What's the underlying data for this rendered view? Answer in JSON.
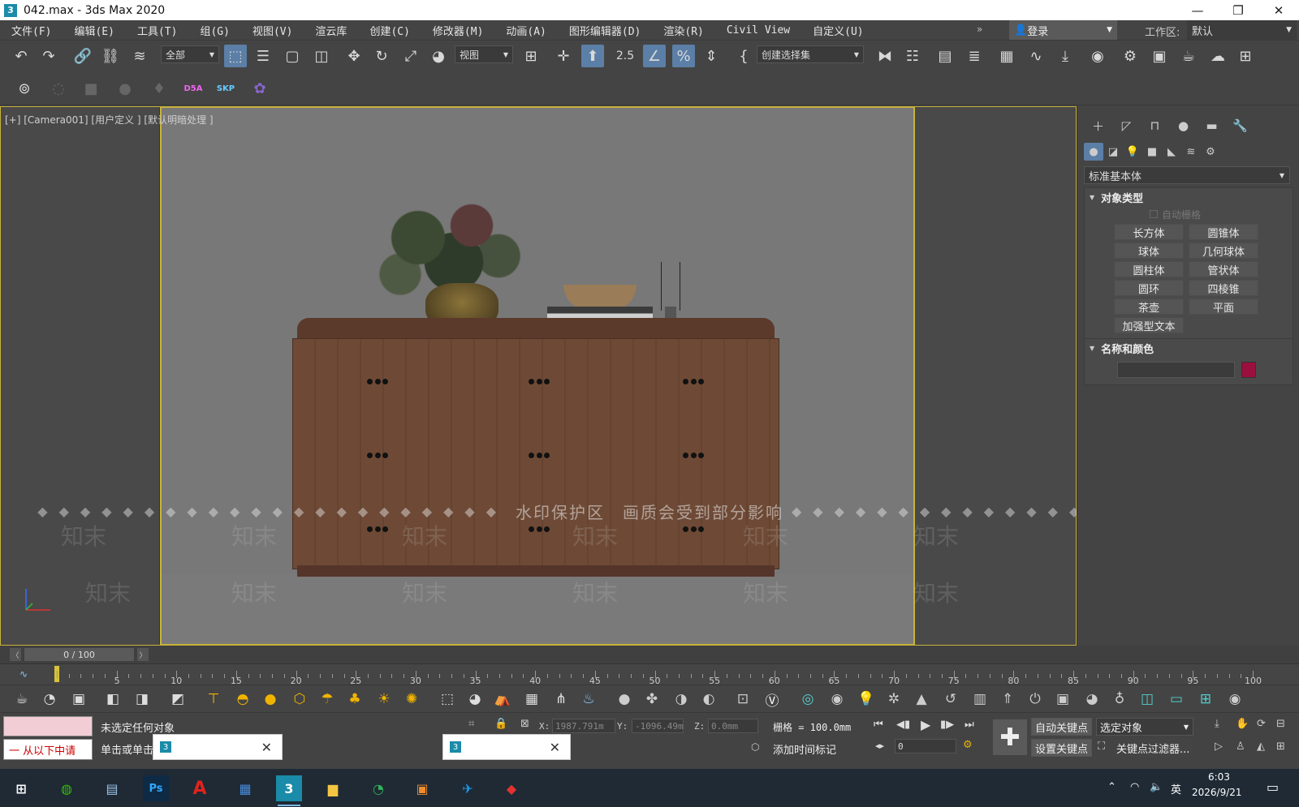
{
  "window": {
    "title": "042.max - 3ds Max 2020",
    "app_icon": "3",
    "controls": [
      "—",
      "❐",
      "✕"
    ]
  },
  "menu": {
    "items": [
      "文件(F)",
      "编辑(E)",
      "工具(T)",
      "组(G)",
      "视图(V)",
      "渲云库",
      "创建(C)",
      "修改器(M)",
      "动画(A)",
      "图形编辑器(D)",
      "渲染(R)",
      "Civil View",
      "自定义(U)"
    ],
    "overflow": "»",
    "login": "登录",
    "workspace_label": "工作区:",
    "workspace_value": "默认"
  },
  "toolbar": {
    "selection_filter": "全部",
    "ref_coord": "视图",
    "named_selection": "创建选择集",
    "snap_value": "2.5"
  },
  "toolbar2": {
    "d5a_label": "D5A",
    "skp_label": "SKP"
  },
  "viewport": {
    "label": "[+] [Camera001] [用户定义 ] [默认明暗处理 ]",
    "watermark_text": "水印保护区　画质会受到部分影响",
    "watermark_logo": "知末"
  },
  "command_panel": {
    "category": "标准基本体",
    "object_type_title": "对象类型",
    "autogrid": "自动栅格",
    "primitives": [
      "长方体",
      "圆锥体",
      "球体",
      "几何球体",
      "圆柱体",
      "管状体",
      "圆环",
      "四棱锥",
      "茶壶",
      "平面",
      "加强型文本"
    ],
    "name_color_title": "名称和颜色",
    "object_color": "#9b0f3e"
  },
  "timeline": {
    "frame_display": "0 / 100",
    "ticks": [
      5,
      10,
      15,
      20,
      25,
      30,
      35,
      40,
      45,
      50,
      55,
      60,
      65,
      70,
      75,
      80,
      85,
      90,
      95,
      100
    ]
  },
  "status": {
    "listener_text": "一 从以下中请",
    "selection_status": "未选定任何对象",
    "prompt": "单击或单击",
    "x_label": "X:",
    "x_value": "1987.791m",
    "y_label": "Y:",
    "y_value": "-1096.49m",
    "z_label": "Z:",
    "z_value": "0.0mm",
    "grid_text": "栅格 = 100.0mm",
    "add_time_tag": "添加时间标记",
    "auto_key": "自动关键点",
    "selected_object": "选定对象",
    "set_key": "设置关键点",
    "key_filters": "关键点过滤器...",
    "current_frame": "0"
  },
  "taskbar": {
    "time": "6:03",
    "date": "2026/9/21",
    "ime": "英"
  }
}
